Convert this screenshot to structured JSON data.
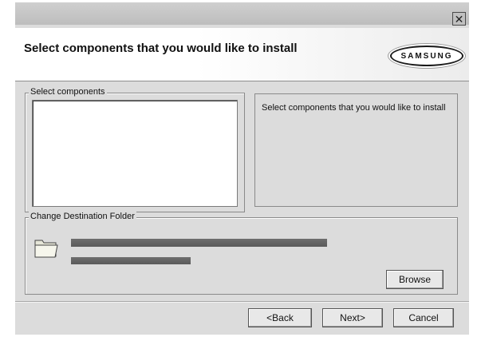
{
  "dialog": {
    "title": "Select components that you would like to install",
    "brand_logo": "SAMSUNG",
    "close_icon": "close-icon"
  },
  "components_group": {
    "legend": "Select components",
    "description": "Select components that you would like to install"
  },
  "destination_group": {
    "legend": "Change Destination Folder",
    "folder_icon": "folder-icon"
  },
  "buttons": {
    "browse": "Browse",
    "back": "<Back",
    "next": "Next>",
    "cancel": "Cancel"
  }
}
